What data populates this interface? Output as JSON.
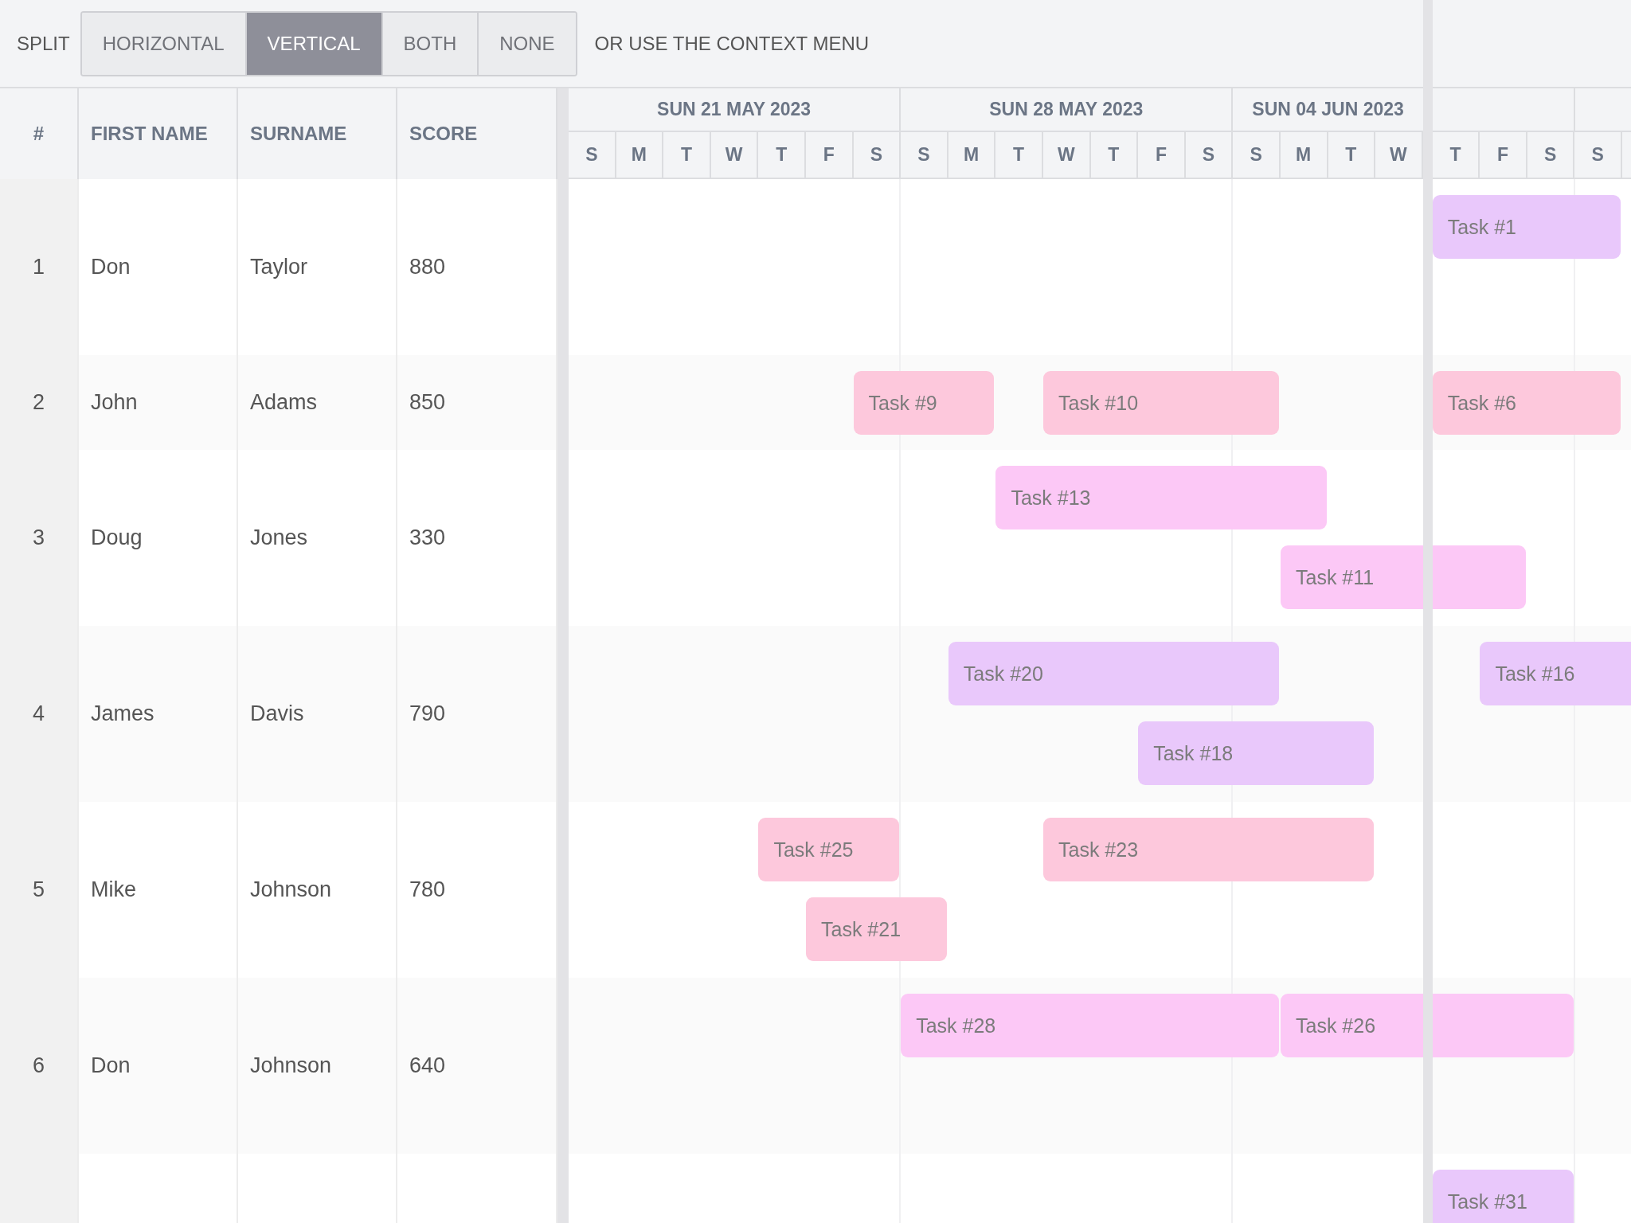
{
  "toolbar": {
    "label": "SPLIT",
    "options": [
      {
        "label": "HORIZONTAL",
        "selected": false
      },
      {
        "label": "VERTICAL",
        "selected": true
      },
      {
        "label": "BOTH",
        "selected": false
      },
      {
        "label": "NONE",
        "selected": false
      }
    ],
    "hint": "OR USE THE CONTEXT MENU"
  },
  "columns": [
    "#",
    "FIRST NAME",
    "SURNAME",
    "SCORE"
  ],
  "timeline": {
    "weeks": [
      "SUN 21 MAY 2023",
      "SUN 28 MAY 2023",
      "SUN 04 JUN 2023"
    ],
    "days": [
      "S",
      "M",
      "T",
      "W",
      "T",
      "F",
      "S",
      "S",
      "M",
      "T",
      "W",
      "T",
      "F",
      "S",
      "S",
      "M",
      "T",
      "W",
      "T",
      "F",
      "S",
      "S"
    ]
  },
  "rows": [
    {
      "number": "1",
      "first_name": "Don",
      "surname": "Taylor",
      "score": "880",
      "lanes": [
        [
          {
            "label": "Task #1",
            "color": "#e9c8fb"
          }
        ]
      ]
    },
    {
      "number": "2",
      "first_name": "John",
      "surname": "Adams",
      "score": "850",
      "lanes": [
        [
          {
            "label": "Task #9",
            "color": "#fdc8dc"
          },
          {
            "label": "Task #10",
            "color": "#fdc8dc"
          },
          {
            "label": "Task #6",
            "color": "#fdc8dc"
          }
        ]
      ]
    },
    {
      "number": "3",
      "first_name": "Doug",
      "surname": "Jones",
      "score": "330",
      "lanes": [
        [
          {
            "label": "Task #13",
            "color": "#fcc8f6"
          }
        ],
        [
          {
            "label": "Task #11",
            "color": "#fcc8f6"
          }
        ]
      ]
    },
    {
      "number": "4",
      "first_name": "James",
      "surname": "Davis",
      "score": "790",
      "lanes": [
        [
          {
            "label": "Task #20",
            "color": "#e9c8fb"
          },
          {
            "label": "Task #16",
            "color": "#e9c8fb"
          }
        ],
        [
          {
            "label": "Task #18",
            "color": "#e9c8fb"
          }
        ]
      ]
    },
    {
      "number": "5",
      "first_name": "Mike",
      "surname": "Johnson",
      "score": "780",
      "lanes": [
        [
          {
            "label": "Task #25",
            "color": "#fdc8dc"
          },
          {
            "label": "Task #23",
            "color": "#fdc8dc"
          }
        ],
        [
          {
            "label": "Task #21",
            "color": "#fdc8dc"
          }
        ]
      ]
    },
    {
      "number": "6",
      "first_name": "Don",
      "surname": "Johnson",
      "score": "640",
      "lanes": [
        [
          {
            "label": "Task #28",
            "color": "#fcc8f6"
          },
          {
            "label": "Task #26",
            "color": "#fcc8f6"
          }
        ]
      ]
    },
    {
      "lanes": [
        [
          {
            "label": "Task #31",
            "color": "#e9c8fb"
          }
        ]
      ]
    }
  ]
}
